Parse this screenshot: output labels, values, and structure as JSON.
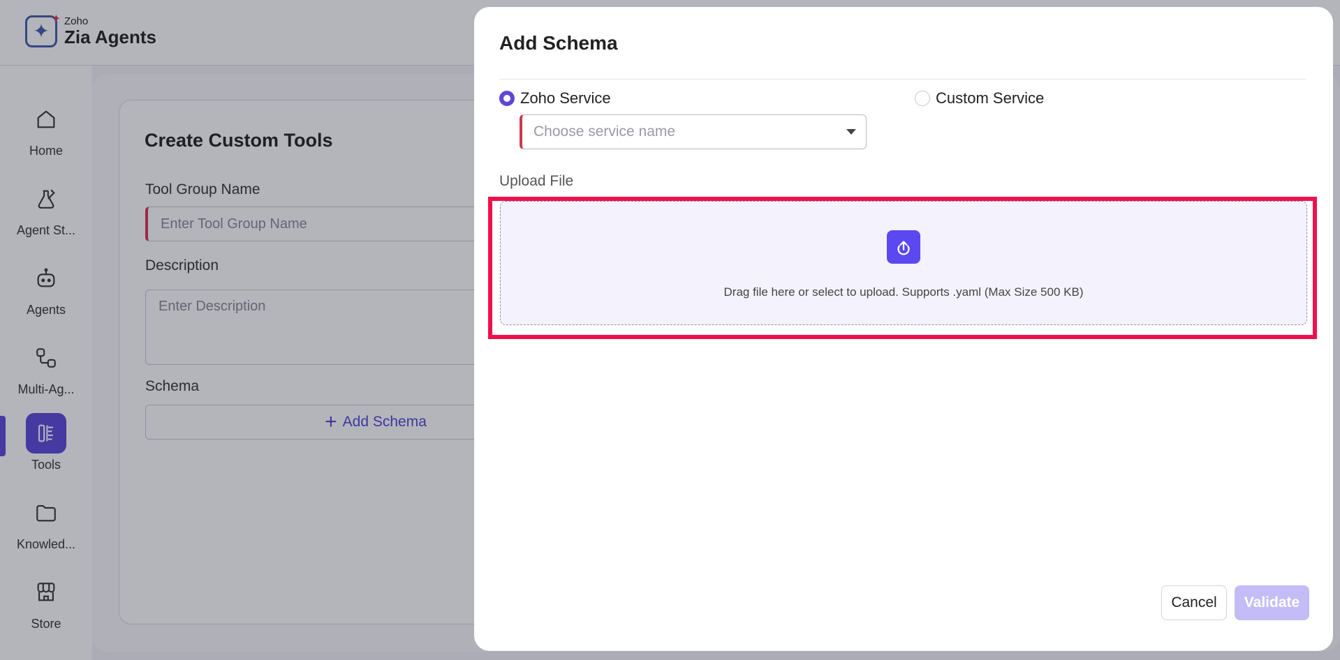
{
  "header": {
    "brand_sub": "Zoho",
    "brand_title": "Zia Agents"
  },
  "sidebar": {
    "items": [
      {
        "label": "Home",
        "icon": "home-icon"
      },
      {
        "label": "Agent St...",
        "icon": "agent-studio-icon"
      },
      {
        "label": "Agents",
        "icon": "robot-icon"
      },
      {
        "label": "Multi-Ag...",
        "icon": "multi-agent-icon"
      },
      {
        "label": "Tools",
        "icon": "tools-icon",
        "active": true
      },
      {
        "label": "Knowled...",
        "icon": "folder-icon"
      },
      {
        "label": "Store",
        "icon": "store-icon"
      }
    ]
  },
  "form": {
    "title": "Create Custom Tools",
    "tool_group_label": "Tool Group Name",
    "tool_group_placeholder": "Enter Tool Group Name",
    "description_label": "Description",
    "description_placeholder": "Enter Description",
    "schema_label": "Schema",
    "add_schema_label": "Add Schema"
  },
  "modal": {
    "title": "Add Schema",
    "options": {
      "zoho_service": "Zoho Service",
      "custom_service": "Custom Service",
      "selected": "Zoho Service"
    },
    "service_placeholder": "Choose service name",
    "upload_label": "Upload File",
    "upload_hint": "Drag file here or select to upload. Supports .yaml (Max Size 500 KB)",
    "cancel_label": "Cancel",
    "validate_label": "Validate"
  },
  "colors": {
    "accent": "#5b48d8",
    "highlight": "#f0104e",
    "required": "#e0304e"
  }
}
